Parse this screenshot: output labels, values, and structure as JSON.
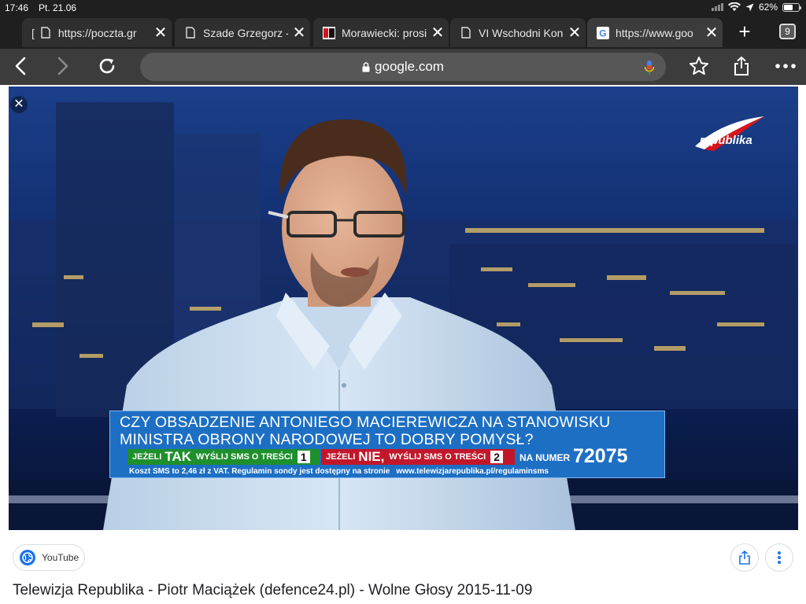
{
  "status_bar": {
    "time": "17:46",
    "date": "Pt. 21.06",
    "battery": "62%",
    "battery_level": 0.62
  },
  "tabs": [
    {
      "title": "https://poczta.gr",
      "favicon": "page-icon"
    },
    {
      "title": "Szade Grzegorz -",
      "favicon": "page-icon"
    },
    {
      "title": "Morawiecki: prosi",
      "favicon": "np-logo"
    },
    {
      "title": "VI Wschodni Kon",
      "favicon": "page-icon"
    },
    {
      "title": "https://www.goo",
      "favicon": "google-icon",
      "active": true
    }
  ],
  "tab_count": "9",
  "toolbar": {
    "url": "google.com"
  },
  "video": {
    "channel_logo": "republika",
    "ticker": {
      "question_line1": "CZY OBSADZENIE ANTONIEGO MACIEREWICZA NA STANOWISKU",
      "question_line2": "MINISTRA OBRONY NARODOWEJ TO DOBRY POMYSŁ?",
      "yes_prefix": "JEŻELI",
      "yes_word": "TAK",
      "yes_suffix": "WYŚLIJ SMS O TREŚCI",
      "yes_code": "1",
      "no_prefix": "JEŻELI",
      "no_word": "NIE,",
      "no_suffix": "WYŚLIJ SMS O TREŚCI",
      "no_code": "2",
      "na_numer": "NA NUMER",
      "sms_number": "72075",
      "footer": "Koszt SMS to 2,46 zł z VAT. Regulamin sondy jest dostępny na stronie",
      "footer_url": "www.telewizjarepublika.pl/regulaminsms"
    }
  },
  "below": {
    "source": "YouTube",
    "caption": "Telewizja Republika - Piotr Maciążek (defence24.pl) - Wolne Głosy 2015-11-09"
  },
  "colors": {
    "tab_bg": "#1f1f1f",
    "toolbar_bg": "#3c3c3c",
    "ticker_blue": "#1d6fc4",
    "yes_green": "#1e8f2d",
    "no_red": "#c2172a"
  }
}
